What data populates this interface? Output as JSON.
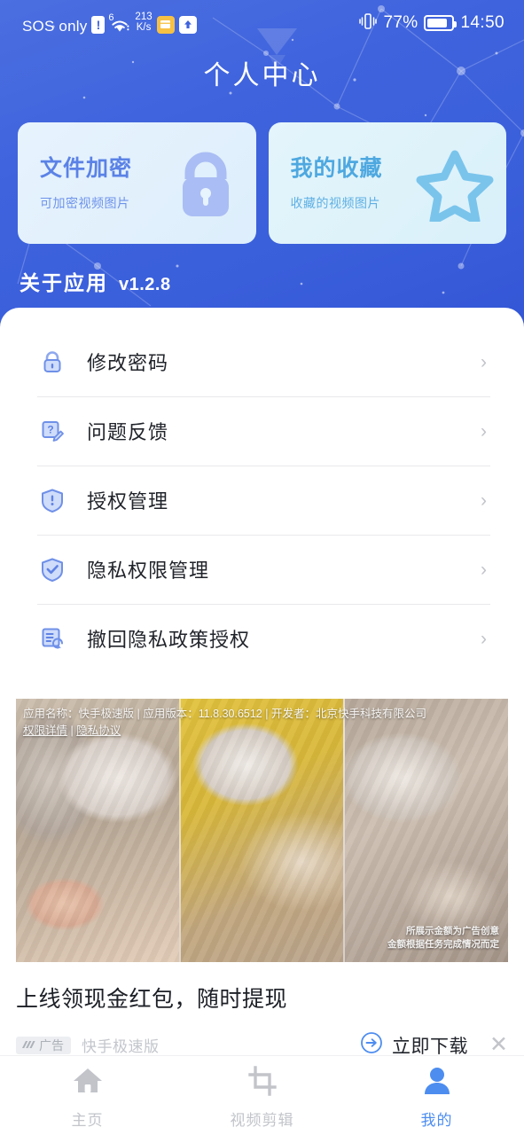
{
  "statusbar": {
    "carrier": "SOS only",
    "alert_badge": "!",
    "wifi_sup": "6",
    "net_speed_value": "213",
    "net_speed_unit": "K/s",
    "icon_card": "card-icon",
    "icon_upload": "upload-arrow-icon",
    "vibrate_icon": "vibrate-icon",
    "battery_pct": "77%",
    "battery_level": 77,
    "time": "14:50"
  },
  "header": {
    "title": "个人中心"
  },
  "cards": [
    {
      "title": "文件加密",
      "subtitle": "可加密视频图片",
      "icon": "lock-icon",
      "accent": "#5b82e6"
    },
    {
      "title": "我的收藏",
      "subtitle": "收藏的视频图片",
      "icon": "star-icon",
      "accent": "#4ea8e0"
    }
  ],
  "about": {
    "label": "关于应用",
    "version": "v1.2.8"
  },
  "settings_list": [
    {
      "label": "修改密码",
      "icon": "lock-icon",
      "chevron": "›"
    },
    {
      "label": "问题反馈",
      "icon": "feedback-pencil-icon",
      "chevron": "›"
    },
    {
      "label": "授权管理",
      "icon": "shield-alert-icon",
      "chevron": "›"
    },
    {
      "label": "隐私权限管理",
      "icon": "shield-check-icon",
      "chevron": "›"
    },
    {
      "label": "撤回隐私政策授权",
      "icon": "document-revoke-icon",
      "chevron": "›"
    }
  ],
  "ad": {
    "legal_line1": "应用名称：快手极速版 | 应用版本：11.8.30.6512 | 开发者：北京快手科技有限公司",
    "legal_permissions": "权限详情",
    "legal_separator": " | ",
    "legal_privacy": "隐私协议",
    "watermark_line1": "所展示金额为广告创意",
    "watermark_line2": "金额根据任务完成情况而定",
    "title": "上线领现金红包，随时提现",
    "badge_label": "广告",
    "brand": "快手极速版",
    "download_label": "立即下载",
    "download_icon": "arrow-right-circle-icon",
    "close_icon": "close-icon",
    "close_glyph": "✕"
  },
  "tabbar": [
    {
      "label": "主页",
      "icon": "home-icon",
      "active": false
    },
    {
      "label": "视频剪辑",
      "icon": "crop-icon",
      "active": false
    },
    {
      "label": "我的",
      "icon": "person-icon",
      "active": true
    }
  ],
  "colors": {
    "brand_blue": "#3f63dd",
    "accent_blue": "#4d8df0",
    "muted": "#c2c4ca",
    "text": "#20232a"
  }
}
